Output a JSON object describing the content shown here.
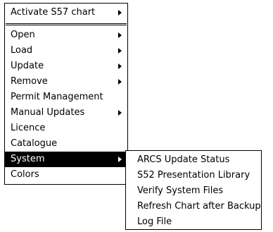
{
  "main_menu": {
    "items": [
      {
        "label": "Activate S57 chart",
        "submenu": true
      },
      {
        "label": "Open",
        "submenu": true
      },
      {
        "label": "Load",
        "submenu": true
      },
      {
        "label": "Update",
        "submenu": true
      },
      {
        "label": "Remove",
        "submenu": true
      },
      {
        "label": "Permit Management",
        "submenu": false
      },
      {
        "label": "Manual Updates",
        "submenu": true
      },
      {
        "label": "Licence",
        "submenu": false
      },
      {
        "label": "Catalogue",
        "submenu": false
      },
      {
        "label": "System",
        "submenu": true,
        "highlighted": true
      },
      {
        "label": "Colors",
        "submenu": false
      }
    ]
  },
  "system_submenu": {
    "items": [
      {
        "label": "ARCS Update Status"
      },
      {
        "label": "S52 Presentation Library"
      },
      {
        "label": "Verify System Files"
      },
      {
        "label": "Refresh Chart after Backup"
      },
      {
        "label": "Log File"
      }
    ]
  },
  "colors": {
    "highlight_bg": "#000000",
    "highlight_fg": "#ffffff",
    "menu_bg": "#ffffff",
    "border": "#000000"
  }
}
